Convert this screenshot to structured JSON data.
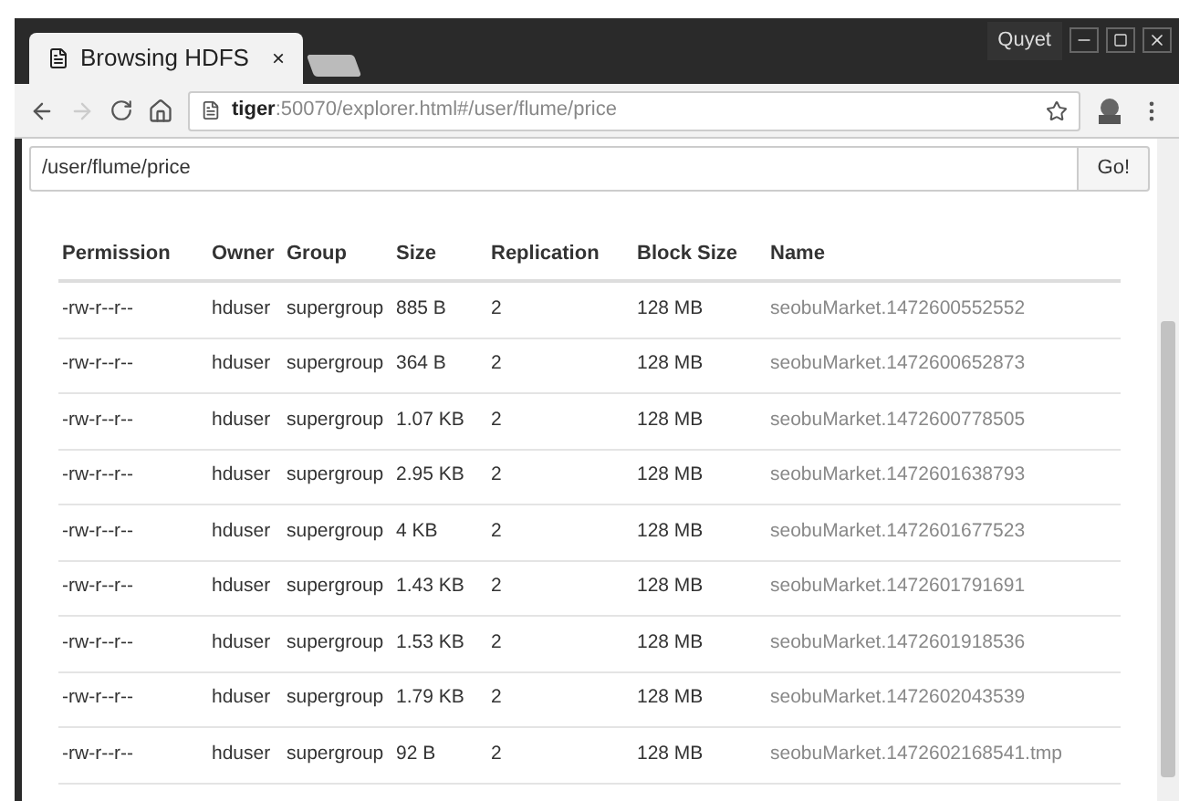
{
  "window": {
    "user": "Quyet"
  },
  "tabs": [
    {
      "title": "Browsing HDFS",
      "close": "×",
      "selected": true
    }
  ],
  "address_bar": {
    "host": "tiger",
    "rest": ":50070/explorer.html#/user/flume/price"
  },
  "path_field": {
    "value": "/user/flume/price"
  },
  "go_button": "Go!",
  "table": {
    "columns": [
      "Permission",
      "Owner",
      "Group",
      "Size",
      "Replication",
      "Block Size",
      "Name"
    ],
    "rows": [
      [
        "-rw-r--r--",
        "hduser",
        "supergroup",
        "885 B",
        "2",
        "128 MB",
        "seobuMarket.1472600552552"
      ],
      [
        "-rw-r--r--",
        "hduser",
        "supergroup",
        "364 B",
        "2",
        "128 MB",
        "seobuMarket.1472600652873"
      ],
      [
        "-rw-r--r--",
        "hduser",
        "supergroup",
        "1.07 KB",
        "2",
        "128 MB",
        "seobuMarket.1472600778505"
      ],
      [
        "-rw-r--r--",
        "hduser",
        "supergroup",
        "2.95 KB",
        "2",
        "128 MB",
        "seobuMarket.1472601638793"
      ],
      [
        "-rw-r--r--",
        "hduser",
        "supergroup",
        "4 KB",
        "2",
        "128 MB",
        "seobuMarket.1472601677523"
      ],
      [
        "-rw-r--r--",
        "hduser",
        "supergroup",
        "1.43 KB",
        "2",
        "128 MB",
        "seobuMarket.1472601791691"
      ],
      [
        "-rw-r--r--",
        "hduser",
        "supergroup",
        "1.53 KB",
        "2",
        "128 MB",
        "seobuMarket.1472601918536"
      ],
      [
        "-rw-r--r--",
        "hduser",
        "supergroup",
        "1.79 KB",
        "2",
        "128 MB",
        "seobuMarket.1472602043539"
      ],
      [
        "-rw-r--r--",
        "hduser",
        "supergroup",
        "92 B",
        "2",
        "128 MB",
        "seobuMarket.1472602168541.tmp"
      ]
    ]
  }
}
